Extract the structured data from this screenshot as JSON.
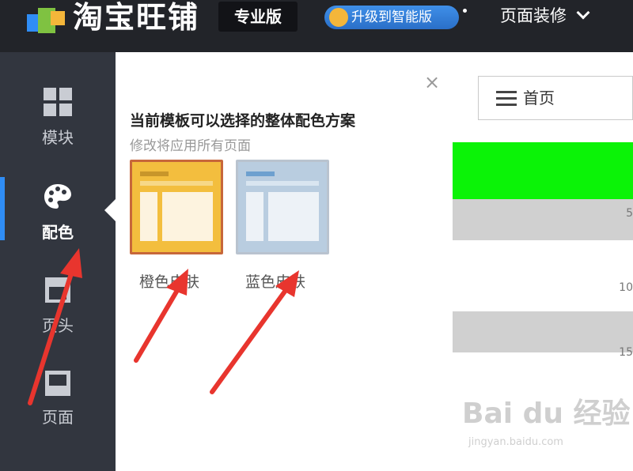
{
  "header": {
    "brand": "淘宝旺铺",
    "edition": "专业版",
    "upgrade": "升级到智能版",
    "decor_menu": "页面装修"
  },
  "sidebar": {
    "items": [
      {
        "label": "模块",
        "icon": "grid-icon"
      },
      {
        "label": "配色",
        "icon": "palette-icon"
      },
      {
        "label": "页头",
        "icon": "page-header-icon"
      },
      {
        "label": "页面",
        "icon": "page-icon"
      }
    ]
  },
  "panel": {
    "title": "当前模板可以选择的整体配色方案",
    "subtitle": "修改将应用所有页面",
    "close": "×",
    "skins": [
      {
        "label": "橙色皮肤",
        "selected": true
      },
      {
        "label": "蓝色皮肤",
        "selected": false
      }
    ]
  },
  "preview": {
    "page_select": "首页",
    "ticks": [
      "5",
      "10",
      "15"
    ]
  },
  "watermark": {
    "text": "Bai du 经验",
    "sub": "jingyan.baidu.com"
  },
  "colors": {
    "topbar": "#222429",
    "sidebar": "#32363f",
    "accent": "#2f8df5",
    "orange_skin": "#f3be3e",
    "blue_skin": "#b9cde0",
    "arrow": "#e8352e",
    "green_block": "#0bf307"
  }
}
